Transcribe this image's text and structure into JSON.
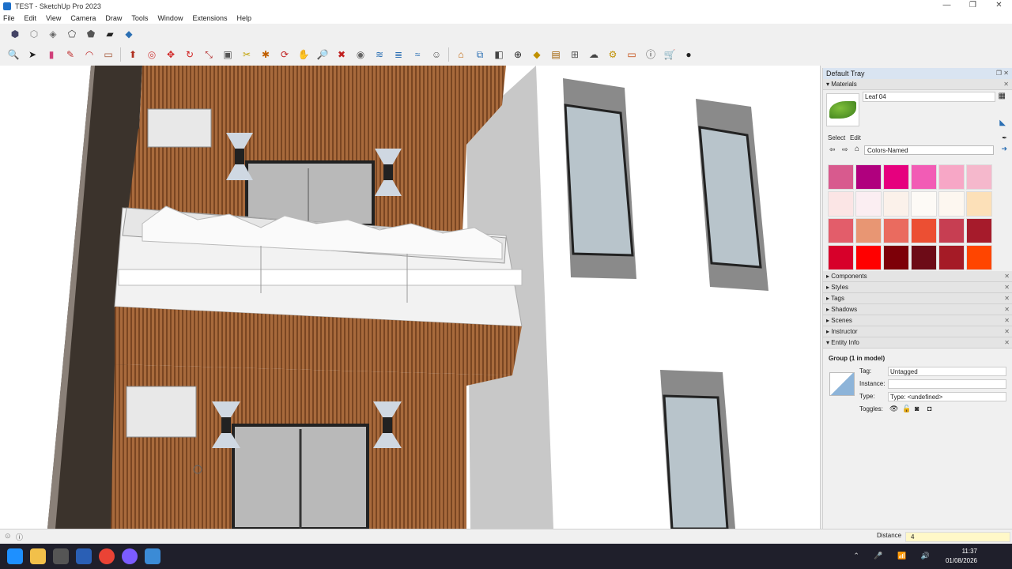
{
  "window": {
    "title": "TEST - SketchUp Pro 2023",
    "min": "—",
    "max": "❐",
    "close": "✕"
  },
  "menu": [
    "File",
    "Edit",
    "View",
    "Camera",
    "Draw",
    "Tools",
    "Window",
    "Extensions",
    "Help"
  ],
  "toolbar_top": [
    "cube-icon",
    "iso-view-icon",
    "top-view-icon",
    "front-view-icon",
    "right-view-icon",
    "back-view-icon",
    "left-view-icon"
  ],
  "toolbar_main": [
    "zoom-icon",
    "select-icon",
    "eraser-icon",
    "pencil-icon",
    "arc-icon",
    "rectangle-icon",
    "push-pull-icon",
    "offset-icon",
    "move-icon",
    "rotate-icon",
    "scale-icon",
    "follow-me-icon",
    "tape-measure-icon",
    "paint-bucket-icon",
    "orbit-icon",
    "pan-icon",
    "zoom-extents-icon",
    "section-plane-icon",
    "axes-icon",
    "position-camera-icon",
    "walk-icon",
    "look-around-icon",
    "components-icon",
    "warehouse-icon",
    "extension-icon",
    "solid-tools-icon",
    "sandbox-icon",
    "dynamic-icon",
    "profile-icon",
    "cart-icon",
    "user-icon"
  ],
  "tray": {
    "title": "Default Tray",
    "materials": {
      "header": "Materials",
      "name": "Leaf 04",
      "tab_select": "Select",
      "tab_edit": "Edit",
      "collection": "Colors-Named",
      "swatches": [
        "#d85a8e",
        "#b0007e",
        "#e6007e",
        "#f25cb5",
        "#f7a7c6",
        "#f5b8cc",
        "#fbe5e5",
        "#fbeef2",
        "#fbf1ea",
        "#fdfaf6",
        "#fdf7f0",
        "#fce0b8",
        "#e35d6a",
        "#e89673",
        "#ea6b5f",
        "#ec4f33",
        "#c73e52",
        "#a61b2b",
        "#d7002a",
        "#ff0000",
        "#7d0008",
        "#6d0b17",
        "#a51b26",
        "#ff4500"
      ]
    },
    "panels": [
      "Components",
      "Styles",
      "Tags",
      "Shadows",
      "Scenes",
      "Instructor"
    ],
    "entity": {
      "header": "Entity Info",
      "group": "Group (1 in model)",
      "tag_label": "Tag:",
      "tag_value": "Untagged",
      "instance_label": "Instance:",
      "instance_value": "",
      "type_label": "Type:",
      "type_value": "Type: <undefined>",
      "toggles_label": "Toggles:"
    }
  },
  "status": {
    "measure_label": "Distance",
    "measure_value": "4"
  },
  "taskbar": {
    "time": "11:37",
    "date": "01/08/2026"
  }
}
